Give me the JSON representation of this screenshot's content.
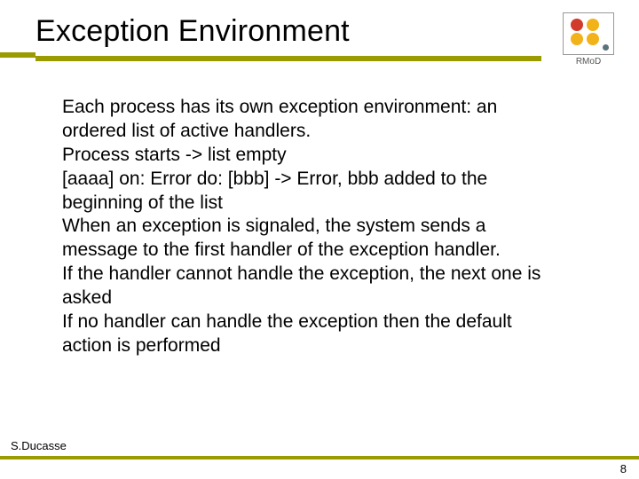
{
  "title": "Exception Environment",
  "logo_label": "RMoD",
  "body": {
    "p1": "Each process has its own exception environment: an ordered list of active handlers.",
    "p2": "Process starts -> list empty",
    "p3": "[aaaa] on: Error do: [bbb] -> Error, bbb added to the beginning of the list",
    "p4": "When an exception is signaled, the system sends a message to the first handler of the exception handler.",
    "p5": "If the handler cannot handle the exception, the next one is asked",
    "p6": "If no handler can handle the exception then the default action is performed"
  },
  "footer_author": "S.Ducasse",
  "page_number": "8"
}
